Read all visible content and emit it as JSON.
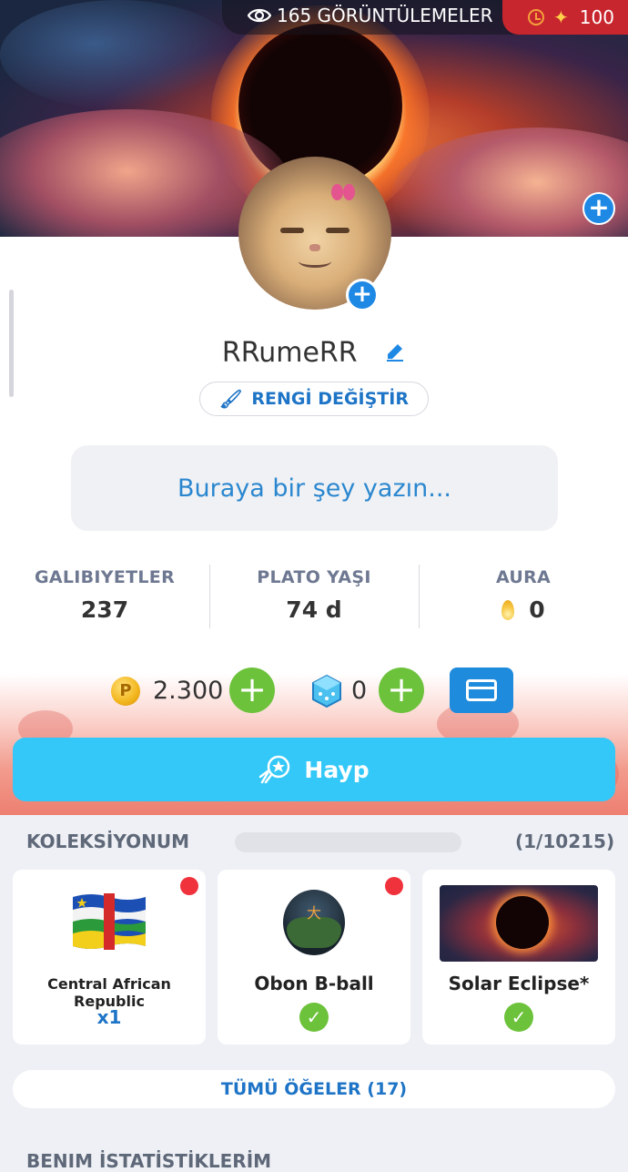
{
  "header": {
    "views_count": "165",
    "views_label": "GÖRÜNTÜLEMELER",
    "energy_value": "100"
  },
  "profile": {
    "username": "RRumeRR",
    "change_color_label": "RENGİ DEĞİŞTİR",
    "status_placeholder": "Buraya bir şey yazın..."
  },
  "stats": [
    {
      "label": "GALIBIYETLER",
      "value": "237"
    },
    {
      "label": "PLATO YAŞI",
      "value": "74 d"
    },
    {
      "label": "AURA",
      "value": "0"
    }
  ],
  "currency": {
    "coins": "2.300",
    "dice": "0"
  },
  "hype_label": "Hayp",
  "collection": {
    "title": "KOLEKSİYONUM",
    "count": "(1/10215)",
    "progress": 0.0001,
    "items": [
      {
        "name": "Central African Republic",
        "qty": "x1",
        "new": true
      },
      {
        "name": "Obon B-ball",
        "owned": true,
        "new": true
      },
      {
        "name": "Solar Eclipse*",
        "owned": true,
        "new": false
      }
    ],
    "all_items_label": "TÜMÜ ÖĞELER (17)"
  },
  "my_stats_title": "BENIM İSTATİSTİKLERİM",
  "colors": {
    "accent_blue": "#1e88e5",
    "hype_blue": "#33c8f8",
    "green": "#6cc23a",
    "red_badge": "#f0323c"
  }
}
